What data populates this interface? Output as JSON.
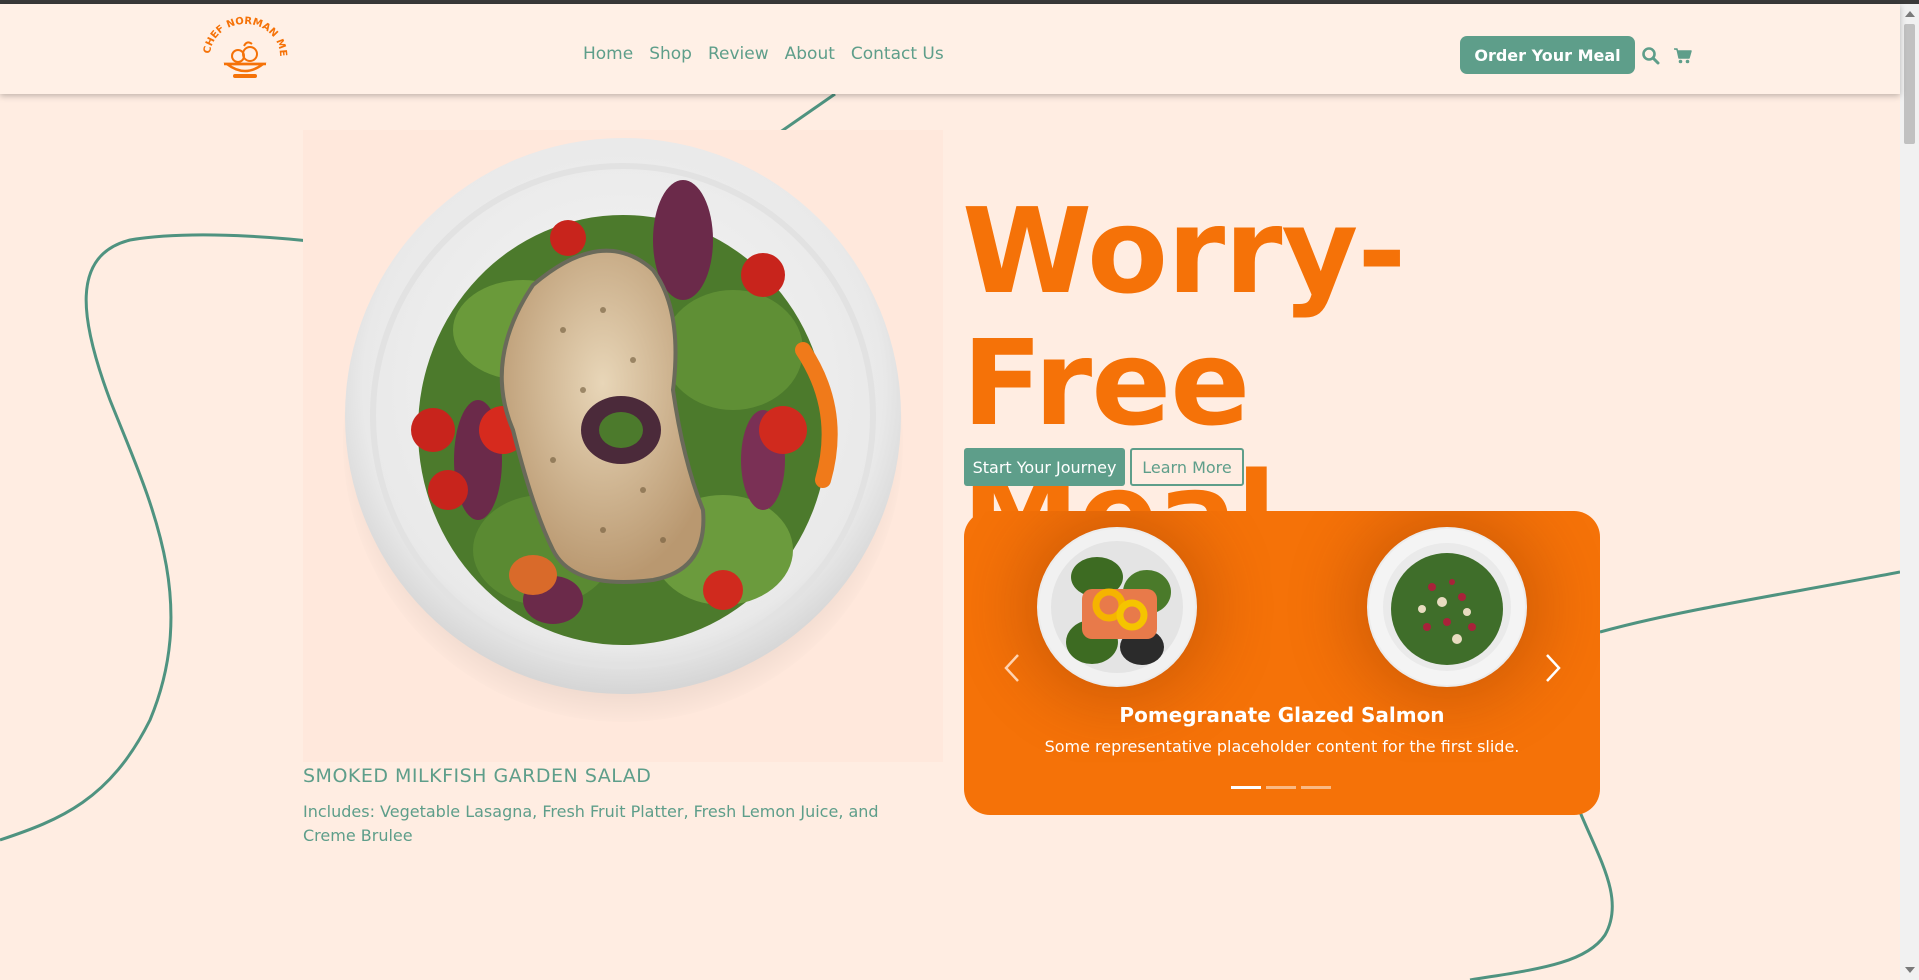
{
  "brand": {
    "logo_text": "CHEF NORMAN MEALS"
  },
  "nav": {
    "links": [
      "Home",
      "Shop",
      "Review",
      "About",
      "Contact Us"
    ],
    "order_button": "Order Your Meal",
    "search_icon": "search-icon",
    "cart_icon": "cart-icon"
  },
  "hero": {
    "headline_line1": "Worry-Free",
    "headline_line2": "Meal Plans.",
    "start_button": "Start Your Journey",
    "learn_button": "Learn More"
  },
  "featured": {
    "title": "SMOKED MILKFISH GARDEN SALAD",
    "description": "Includes: Vegetable Lasagna, Fresh Fruit Platter, Fresh Lemon Juice, and Creme Brulee"
  },
  "carousel": {
    "caption_title": "Pomegranate Glazed Salmon",
    "caption_text": "Some representative placeholder content for the first slide.",
    "slide_count": 3,
    "active_slide": 1
  },
  "colors": {
    "accent": "#f57208",
    "teal": "#5e9e8a",
    "background": "#ffede2"
  }
}
